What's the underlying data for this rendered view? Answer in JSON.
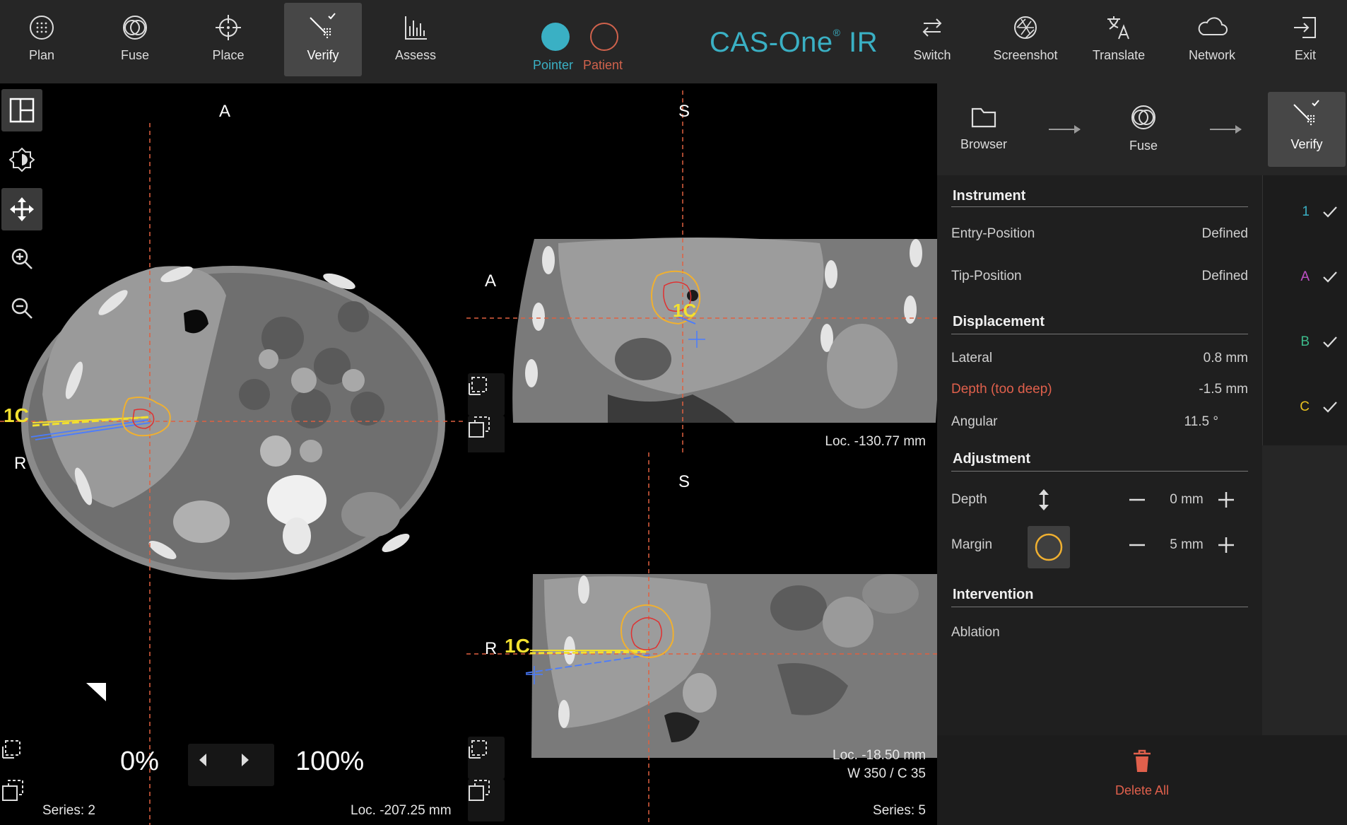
{
  "toolbar": {
    "items": [
      {
        "label": "Plan",
        "icon": "plan-icon"
      },
      {
        "label": "Fuse",
        "icon": "fuse-icon"
      },
      {
        "label": "Place",
        "icon": "crosshair-icon"
      },
      {
        "label": "Verify",
        "icon": "verify-icon",
        "active": true
      },
      {
        "label": "Assess",
        "icon": "bar-chart-icon"
      }
    ],
    "pointer_label": "Pointer",
    "patient_label": "Patient",
    "brand": "CAS-One",
    "brand_suffix": "IR",
    "brand_mark": "®",
    "right_items": [
      {
        "label": "Switch",
        "icon": "switch-icon"
      },
      {
        "label": "Screenshot",
        "icon": "camera-shutter-icon"
      },
      {
        "label": "Translate",
        "icon": "translate-icon"
      },
      {
        "label": "Network",
        "icon": "cloud-icon"
      },
      {
        "label": "Exit",
        "icon": "exit-icon"
      }
    ],
    "colors": {
      "pointer": "#3ab0c4",
      "patient": "#d0624c",
      "brand": "#3ab0c4"
    }
  },
  "left_tools": [
    "layout-icon",
    "brightness-icon",
    "pan-icon",
    "zoom-in-icon",
    "zoom-out-icon"
  ],
  "axial_view": {
    "orient_top": "A",
    "orient_left": "R",
    "trajectory_label": "1C",
    "opacity_min": "0%",
    "opacity_max": "100%",
    "series": "Series: 2",
    "location": "Loc. -207.25 mm"
  },
  "coronal_view": {
    "orient_top": "S",
    "orient_left": "A",
    "trajectory_label": "1C",
    "location": "Loc. -130.77 mm"
  },
  "sagittal_view": {
    "orient_top": "S",
    "orient_left": "R",
    "trajectory_label": "1C",
    "location": "Loc. -18.50 mm",
    "window": "W 350 / C 35",
    "series": "Series: 5"
  },
  "workflow": {
    "steps": [
      {
        "label": "Browser",
        "icon": "folder-icon"
      },
      {
        "label": "Fuse",
        "icon": "fuse-icon"
      },
      {
        "label": "Verify",
        "icon": "verify-icon",
        "active": true
      }
    ]
  },
  "details": {
    "instrument": {
      "title": "Instrument",
      "entry_label": "Entry-Position",
      "entry_value": "Defined",
      "tip_label": "Tip-Position",
      "tip_value": "Defined"
    },
    "displacement": {
      "title": "Displacement",
      "lateral_label": "Lateral",
      "lateral_value": "0.8 mm",
      "depth_label": "Depth (too deep)",
      "depth_value": "-1.5 mm",
      "angular_label": "Angular",
      "angular_value": "11.5 °"
    },
    "adjustment": {
      "title": "Adjustment",
      "depth_label": "Depth",
      "depth_value": "0 mm",
      "margin_label": "Margin",
      "margin_value": "5 mm"
    },
    "intervention": {
      "title": "Intervention",
      "type": "Ablation"
    }
  },
  "trajectories": [
    {
      "id": "1",
      "color": "#3ab0c4",
      "checked": true
    },
    {
      "id": "A",
      "color": "#c050c8",
      "checked": true
    },
    {
      "id": "B",
      "color": "#3cba8a",
      "checked": true
    },
    {
      "id": "C",
      "color": "#e6c020",
      "checked": true
    }
  ],
  "delete_all_label": "Delete All",
  "colors": {
    "warning": "#e0604c",
    "target_outline": "#f0b030",
    "target_core": "#e03030",
    "needle": "#4a7cff",
    "trajectory": "#f2e030"
  }
}
